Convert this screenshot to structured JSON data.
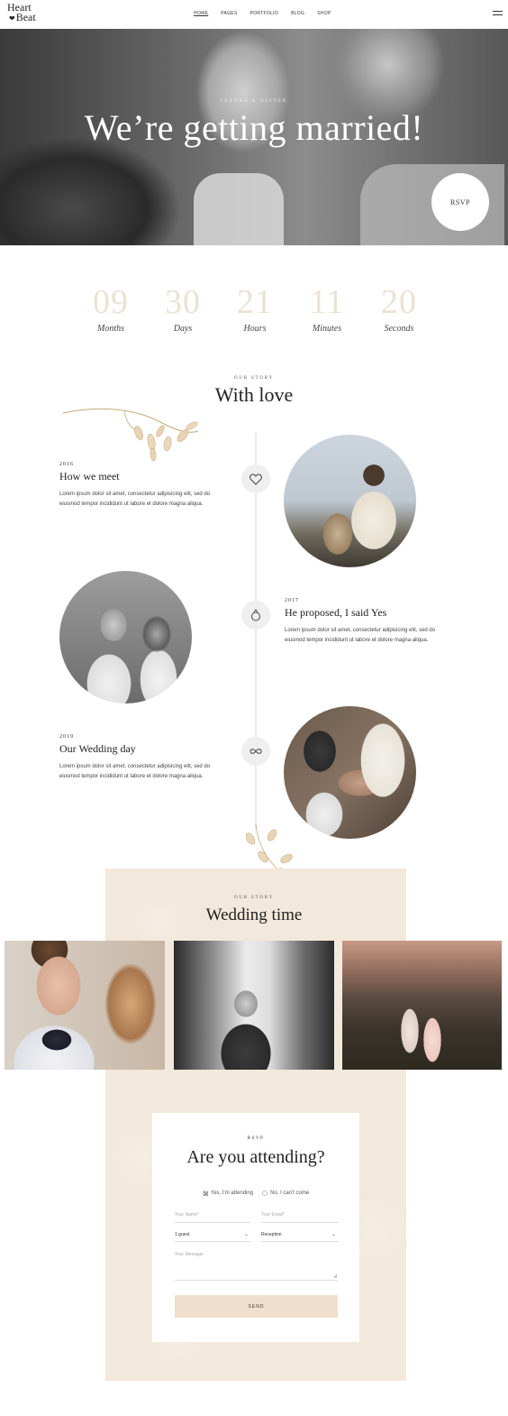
{
  "nav": {
    "logo_line1": "Heart",
    "logo_line2": "Beat",
    "menu": [
      "HOME",
      "PAGES",
      "PORTFOLIO",
      "BLOG",
      "SHOP"
    ]
  },
  "hero": {
    "names": "JOANNA & OLIVER",
    "title": "We’re getting married!",
    "rsvp_label": "RSVP"
  },
  "countdown": [
    {
      "value": "09",
      "label": "Months"
    },
    {
      "value": "30",
      "label": "Days"
    },
    {
      "value": "21",
      "label": "Hours"
    },
    {
      "value": "11",
      "label": "Minutes"
    },
    {
      "value": "20",
      "label": "Seconds"
    }
  ],
  "story": {
    "eyebrow": "OUR STORY",
    "title": "With love",
    "events": [
      {
        "year": "2016",
        "title": "How we meet",
        "text": "Lorem ipsum dolor sit amet, consectetur adipisicing elit, sed do eiusmod tempor incididunt ut labore et dolore magna aliqua.",
        "icon": "heart-icon"
      },
      {
        "year": "2017",
        "title": "He proposed, I said Yes",
        "text": "Lorem ipsum dolor sit amet, consectetur adipisicing elit, sed do eiusmod tempor incididunt ut labore et dolore magna aliqua.",
        "icon": "ring-icon"
      },
      {
        "year": "2019",
        "title": "Our Wedding day",
        "text": "Lorem ipsum dolor sit amet, consectetur adipisicing elit, sed do eiusmod tempor incididunt ut labore et dolore magna aliqua.",
        "icon": "infinity-icon"
      }
    ]
  },
  "wedding": {
    "eyebrow": "OUR STORY",
    "title": "Wedding time"
  },
  "rsvp": {
    "eyebrow": "RSVP",
    "title": "Are you attending?",
    "option_yes": "Yes, I'm attending",
    "option_no": "No, I can't come",
    "name_placeholder": "Your Name*",
    "email_placeholder": "Your Email*",
    "guests_value": "1 guest",
    "event_value": "Reception",
    "message_placeholder": "Your Message",
    "send_label": "SEND"
  },
  "colors": {
    "accent_beige": "#f3e8dc",
    "button": "#f0dfcc",
    "countdown_number": "#ece2d3"
  }
}
